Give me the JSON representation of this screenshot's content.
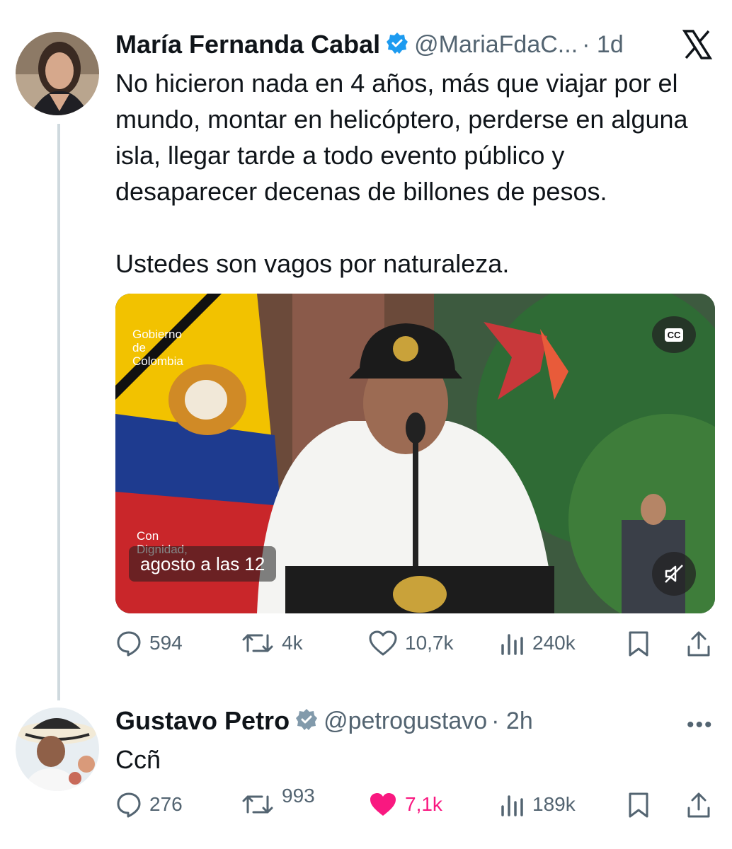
{
  "tweet1": {
    "author_name": "María Fernanda Cabal",
    "handle": "@MariaFdaC...",
    "time": "· 1d",
    "text_paragraphs": [
      "No hicieron nada en 4 años, más que viajar por el mundo, montar en helicóptero, perderse en alguna isla, llegar tarde a todo evento público y desaparecer decenas de billones de pesos.",
      "Ustedes son vagos por naturaleza."
    ],
    "video": {
      "overlay_logo": "Gobierno de Colombia",
      "overlay_slogan": "Con Dignidad,",
      "caption": "agosto a las 12",
      "cc_label": "CC"
    },
    "stats": {
      "replies": "594",
      "retweets": "4k",
      "likes": "10,7k",
      "views": "240k"
    }
  },
  "tweet2": {
    "author_name": "Gustavo Petro",
    "handle": "@petrogustavo",
    "time": "· 2h",
    "text": "Ccñ",
    "stats": {
      "replies": "276",
      "retweets": "993",
      "likes": "7,1k",
      "views": "189k"
    }
  },
  "colors": {
    "like_pink": "#f91880",
    "verified_blue": "#1d9bf0",
    "verified_gray": "#829aab",
    "muted_text": "#536471"
  },
  "icons": [
    "x-logo-icon",
    "reply-icon",
    "retweet-icon",
    "like-icon",
    "views-icon",
    "bookmark-icon",
    "share-icon",
    "cc-icon",
    "mute-icon",
    "more-icon"
  ]
}
